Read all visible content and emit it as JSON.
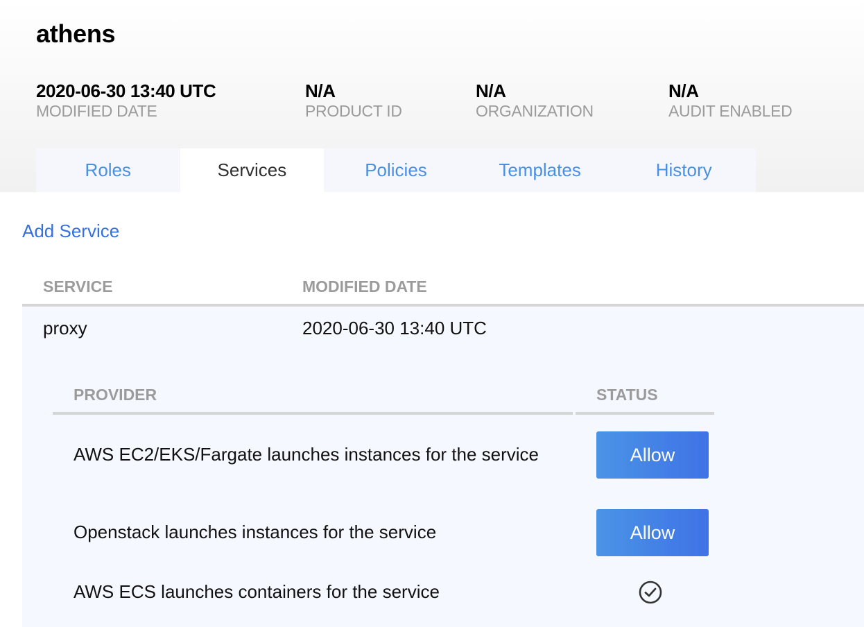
{
  "header": {
    "title": "athens",
    "meta": [
      {
        "value": "2020-06-30 13:40 UTC",
        "label": "MODIFIED DATE"
      },
      {
        "value": "N/A",
        "label": "PRODUCT ID"
      },
      {
        "value": "N/A",
        "label": "ORGANIZATION"
      },
      {
        "value": "N/A",
        "label": "AUDIT ENABLED"
      }
    ]
  },
  "tabs": [
    {
      "label": "Roles",
      "active": false
    },
    {
      "label": "Services",
      "active": true
    },
    {
      "label": "Policies",
      "active": false
    },
    {
      "label": "Templates",
      "active": false
    },
    {
      "label": "History",
      "active": false
    }
  ],
  "actions": {
    "add_service": "Add Service"
  },
  "services_table": {
    "columns": [
      "SERVICE",
      "MODIFIED DATE"
    ],
    "rows": [
      {
        "service": "proxy",
        "modified_date": "2020-06-30 13:40 UTC",
        "providers": {
          "columns": [
            "PROVIDER",
            "STATUS"
          ],
          "rows": [
            {
              "provider": "AWS EC2/EKS/Fargate launches instances for the service",
              "status": "Allow",
              "status_type": "button"
            },
            {
              "provider": "Openstack launches instances for the service",
              "status": "Allow",
              "status_type": "button"
            },
            {
              "provider": "AWS ECS launches containers for the service",
              "status": "enabled",
              "status_type": "check-circle-icon"
            }
          ]
        }
      }
    ]
  },
  "colors": {
    "link": "#4a90e2",
    "accent": "#3f72e6",
    "row_bg": "#f5f8fe",
    "muted_text": "#9b9b9b"
  }
}
